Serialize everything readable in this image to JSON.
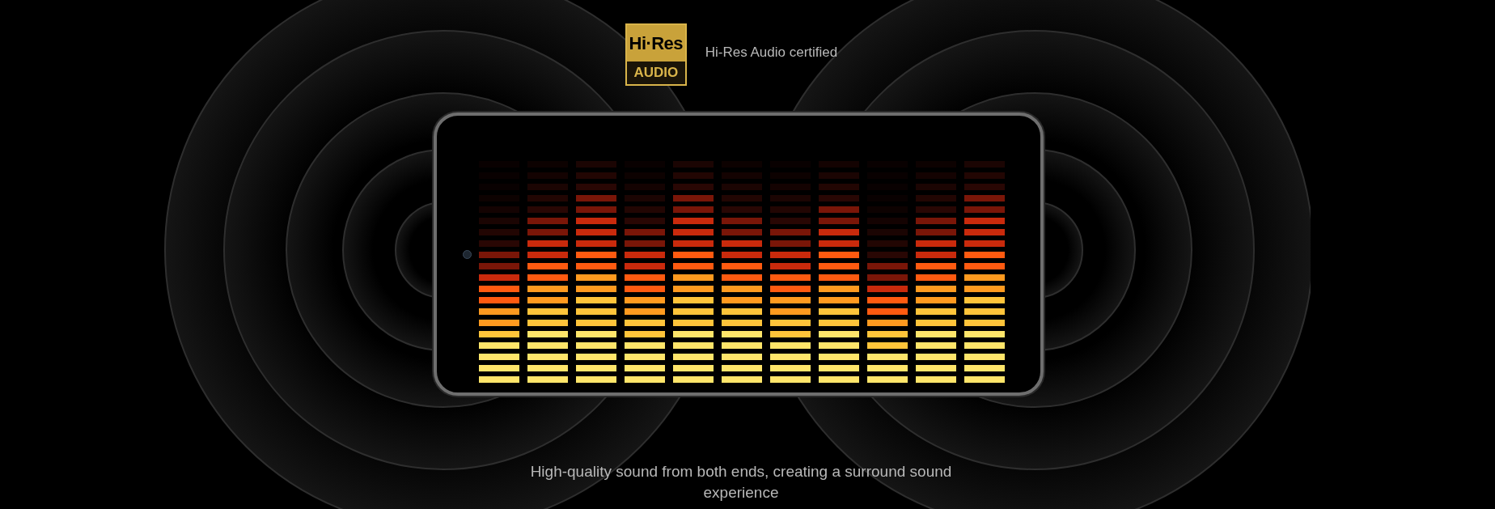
{
  "badge": {
    "line_1": "Hi·Res",
    "line_2": "AUDIO"
  },
  "certification": "Hi-Res Audio certified",
  "caption": "High-quality sound from both ends, creating a surround sound experience"
}
